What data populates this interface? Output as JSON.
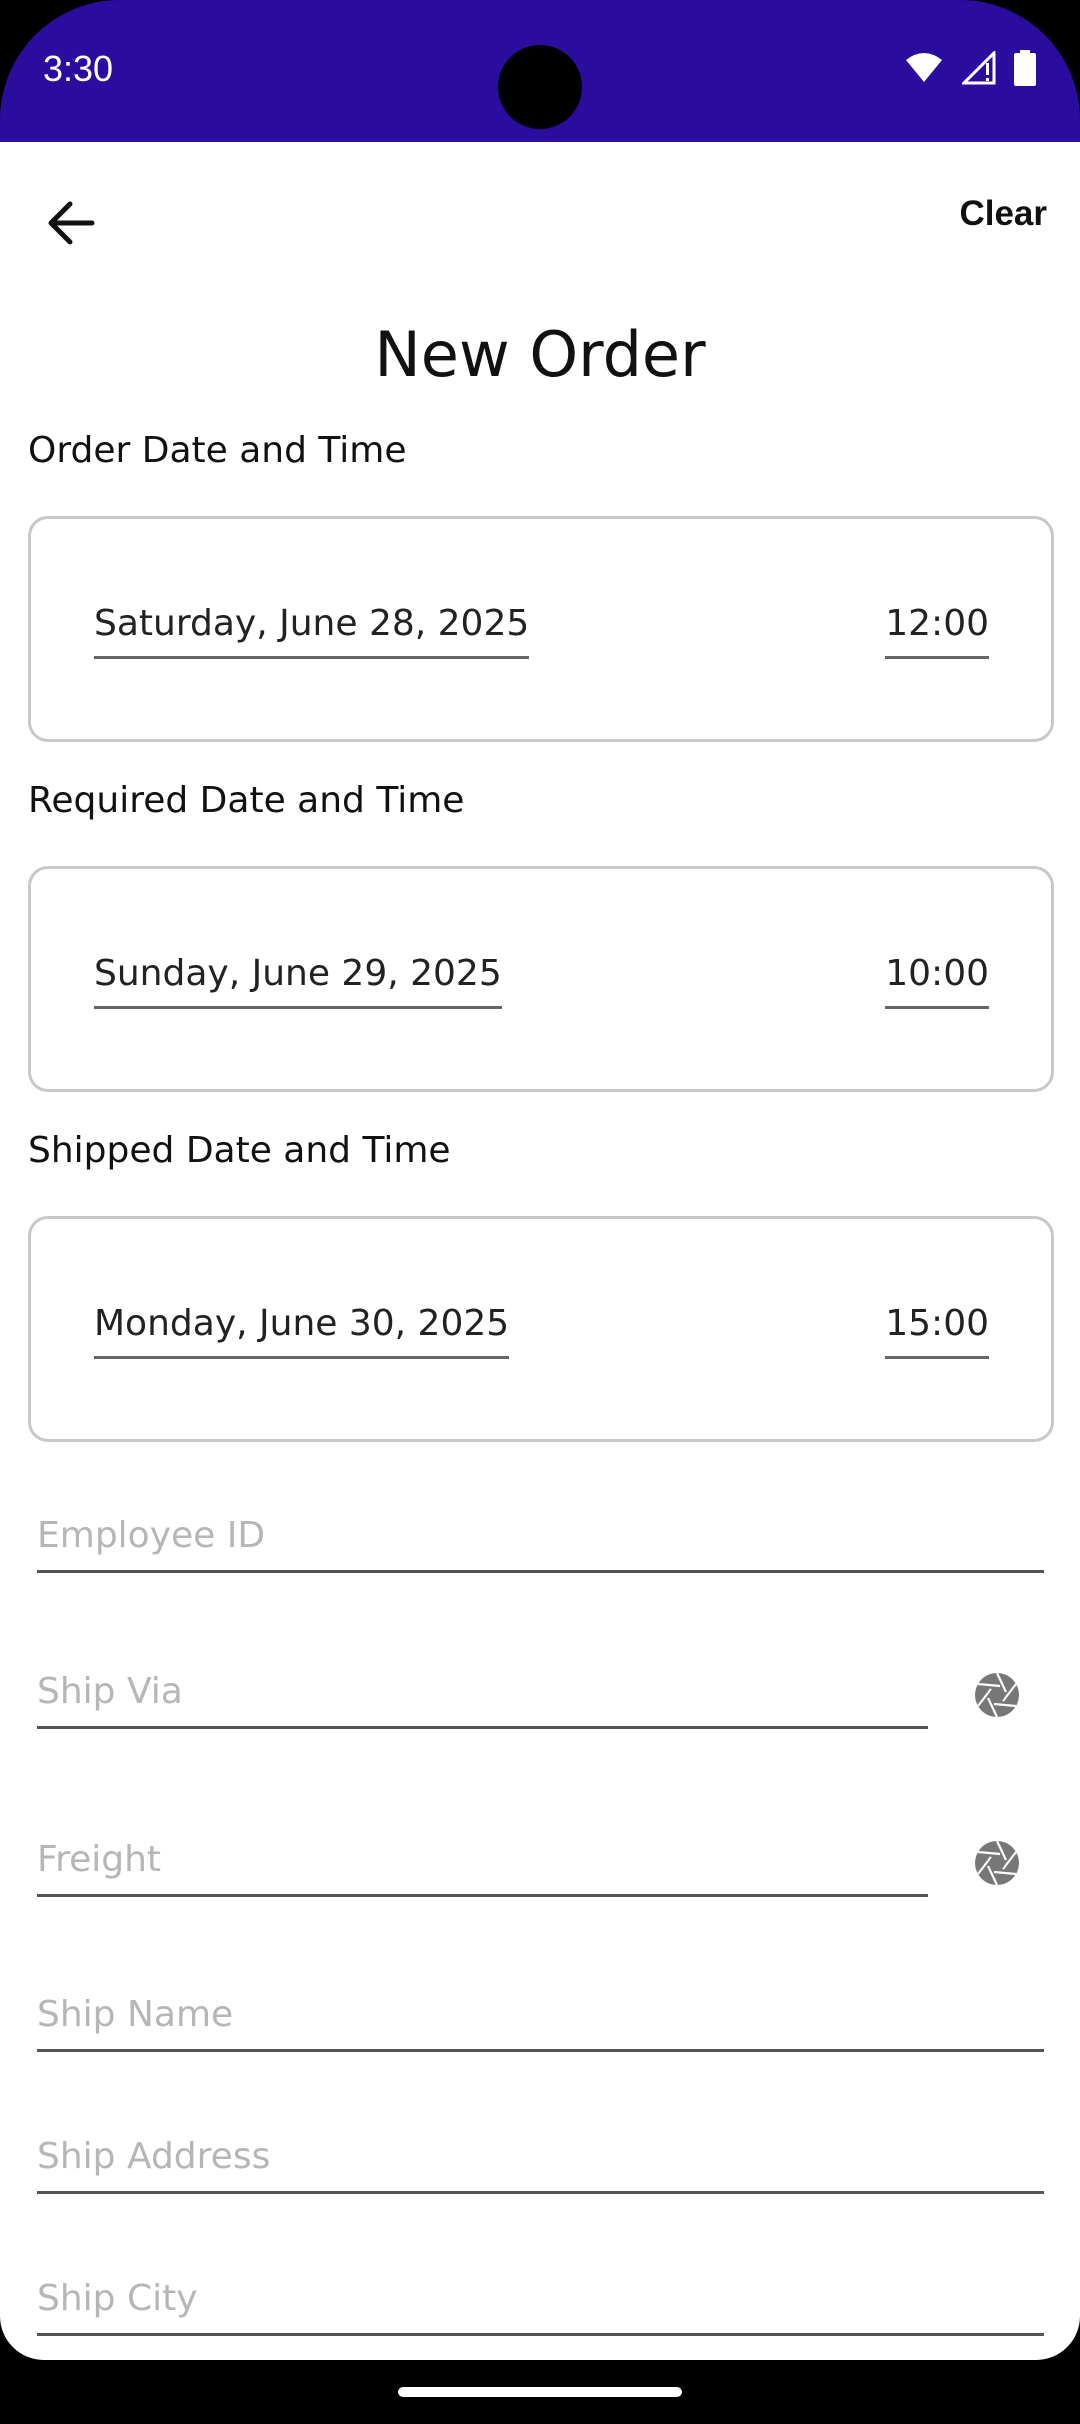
{
  "status_bar": {
    "time": "3:30",
    "icons": [
      "wifi-icon",
      "signal-icon",
      "battery-icon"
    ]
  },
  "toolbar": {
    "back_icon": "arrow-left-icon",
    "clear_label": "Clear"
  },
  "page": {
    "title": "New Order"
  },
  "sections": [
    {
      "label": "Order Date and Time",
      "date": "Saturday, June 28, 2025",
      "time": "12:00"
    },
    {
      "label": "Required Date and Time",
      "date": "Sunday, June 29, 2025",
      "time": "10:00"
    },
    {
      "label": "Shipped Date and Time",
      "date": "Monday, June 30, 2025",
      "time": "15:00"
    }
  ],
  "fields": {
    "employee_id": {
      "placeholder": "Employee ID"
    },
    "ship_via": {
      "placeholder": "Ship Via",
      "icon": "aperture-icon"
    },
    "freight": {
      "placeholder": "Freight",
      "icon": "aperture-icon"
    },
    "ship_name": {
      "placeholder": "Ship Name"
    },
    "ship_address": {
      "placeholder": "Ship Address"
    },
    "ship_city": {
      "placeholder": "Ship City"
    }
  },
  "colors": {
    "status_bar": "#2a0d9e",
    "background": "#ffffff",
    "placeholder": "#b6b6b6"
  }
}
